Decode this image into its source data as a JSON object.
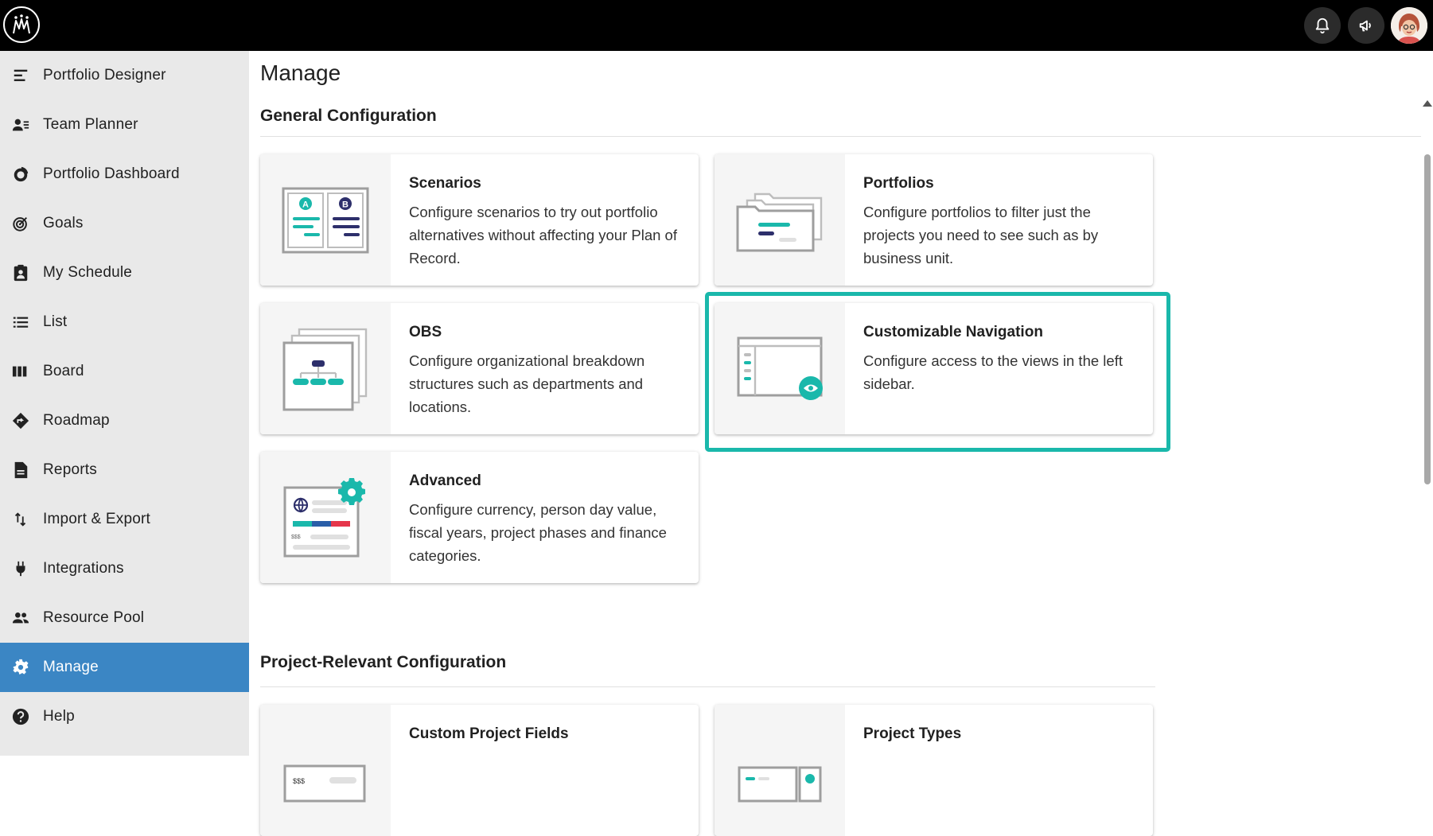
{
  "topbar": {
    "logo_icon": "mm-logo-icon",
    "notifications_icon": "bell-icon",
    "announcements_icon": "megaphone-icon",
    "avatar_icon": "user-avatar"
  },
  "sidebar": {
    "items": [
      {
        "label": "Portfolio Designer",
        "icon": "portfolio-designer-icon"
      },
      {
        "label": "Team Planner",
        "icon": "team-planner-icon"
      },
      {
        "label": "Portfolio Dashboard",
        "icon": "dashboard-icon"
      },
      {
        "label": "Goals",
        "icon": "target-icon"
      },
      {
        "label": "My Schedule",
        "icon": "clipboard-user-icon"
      },
      {
        "label": "List",
        "icon": "list-icon"
      },
      {
        "label": "Board",
        "icon": "board-icon"
      },
      {
        "label": "Roadmap",
        "icon": "roadmap-icon"
      },
      {
        "label": "Reports",
        "icon": "document-icon"
      },
      {
        "label": "Import & Export",
        "icon": "import-export-icon"
      },
      {
        "label": "Integrations",
        "icon": "plug-icon"
      },
      {
        "label": "Resource Pool",
        "icon": "people-icon"
      },
      {
        "label": "Manage",
        "icon": "gear-icon"
      },
      {
        "label": "Help",
        "icon": "help-icon"
      }
    ],
    "active": "Manage"
  },
  "main": {
    "title": "Manage",
    "general": {
      "title": "General Configuration",
      "cards": [
        {
          "title": "Scenarios",
          "desc": "Configure scenarios to try out portfolio alternatives without affecting your Plan of Record."
        },
        {
          "title": "Portfolios",
          "desc": "Configure portfolios to filter just the projects you need to see such as by business unit."
        },
        {
          "title": "OBS",
          "desc": "Configure organizational breakdown structures such as departments and locations."
        },
        {
          "title": "Customizable Navigation",
          "desc": "Configure access to the views in the left sidebar."
        },
        {
          "title": "Advanced",
          "desc": "Configure currency, person day value, fiscal years, project phases and finance categories."
        }
      ]
    },
    "project": {
      "title": "Project-Relevant Configuration",
      "cards": [
        {
          "title": "Custom Project Fields"
        },
        {
          "title": "Project Types"
        }
      ]
    }
  },
  "colors": {
    "accent": "#1ab8ab",
    "navy": "#2d2f6b",
    "active_nav": "#3b86c4",
    "red": "#e5364b",
    "blue": "#2a5ea8"
  }
}
